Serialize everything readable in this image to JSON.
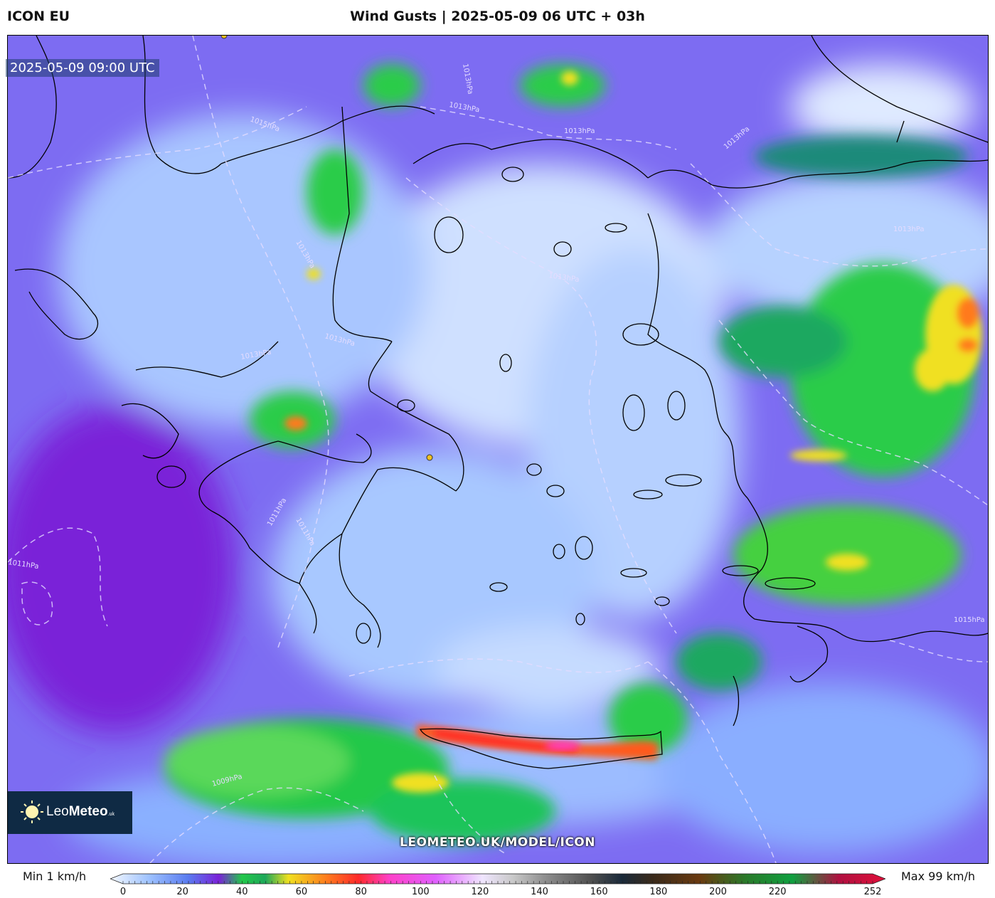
{
  "header": {
    "model_name": "ICON EU",
    "title": "Wind Gusts | 2025-05-09 06 UTC + 03h"
  },
  "map": {
    "valid_time": "2025-05-09 09:00 UTC",
    "isobars": [
      "1015hPa",
      "1013hPa",
      "1013hPa",
      "1013hPa",
      "1013hPa",
      "1013hPa",
      "1013hPa",
      "1013hPa",
      "1013hPa",
      "1013hPa",
      "1011hPa",
      "1011hPa",
      "1011hPa",
      "1009hPa",
      "1015hPa"
    ],
    "watermark": "LEOMETEO.UK/MODEL/ICON"
  },
  "logo": {
    "name_regular": "Leo",
    "name_bold": "Meteo",
    "suffix": ".uk"
  },
  "legend": {
    "min_label": "Min 1 km/h",
    "max_label": "Max 99 km/h",
    "ticks": [
      "0",
      "20",
      "40",
      "60",
      "80",
      "100",
      "120",
      "140",
      "160",
      "180",
      "200",
      "220",
      "252"
    ],
    "colors": {
      "calm": "#e8f0ff",
      "light": "#9ec2ff",
      "moderate": "#6a5cf0",
      "fresh": "#7a22d8",
      "strong": "#22c84a",
      "gale": "#f0e020",
      "storm": "#ff5a1e",
      "violent": "#ff40c8"
    }
  }
}
